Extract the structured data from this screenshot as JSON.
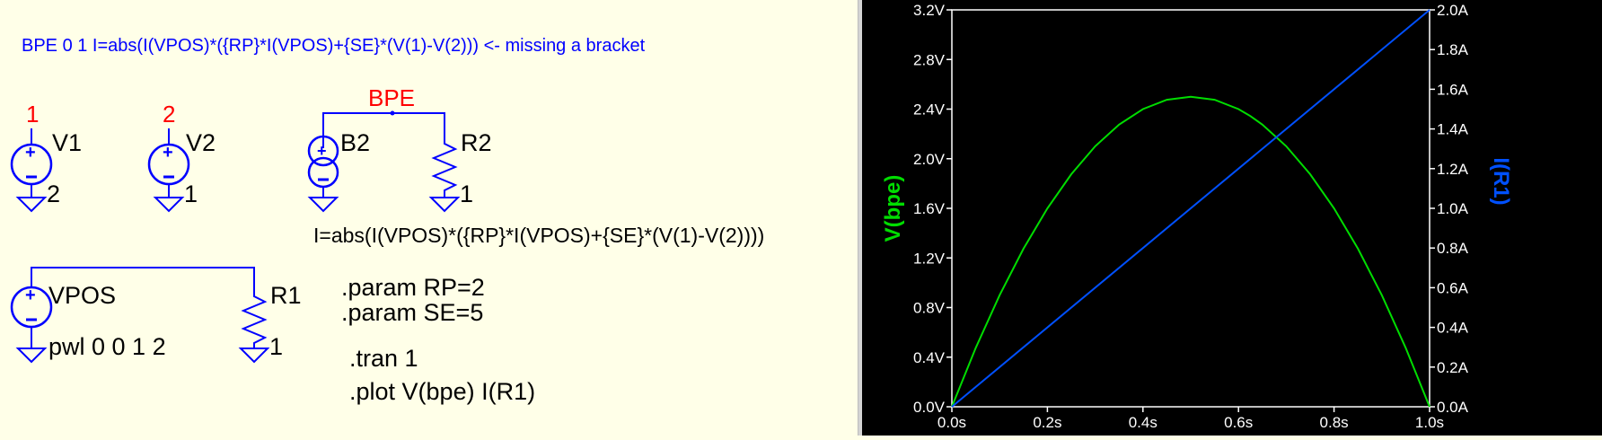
{
  "schematic": {
    "comment": "BPE 0 1 I=abs(I(VPOS)*({RP}*I(VPOS)+{SE}*(V(1)-V(2))) <- missing a bracket",
    "net_labels": {
      "n1": "1",
      "n2": "2",
      "bpe": "BPE"
    },
    "components": {
      "v1": {
        "name": "V1",
        "node": "2"
      },
      "v2": {
        "name": "V2",
        "node": "1"
      },
      "b2": {
        "name": "B2"
      },
      "r2": {
        "name": "R2",
        "value": "1"
      },
      "vpos": {
        "name": "VPOS",
        "value": "pwl 0 0 1 2"
      },
      "r1": {
        "name": "R1",
        "value": "1"
      }
    },
    "b2_expression": "I=abs(I(VPOS)*({RP}*I(VPOS)+{SE}*(V(1)-V(2))))",
    "directives": {
      "param_rp": ".param RP=2",
      "param_se": ".param SE=5",
      "tran": ".tran 1",
      "plot": ".plot V(bpe) I(R1)"
    }
  },
  "colors": {
    "wire": "#0000ff",
    "net_label": "#ff0000",
    "text": "#000000",
    "comment": "#0000ff",
    "plot_bg": "#000000",
    "axis": "#ffffff",
    "trace_vbpe": "#00dd00",
    "trace_ir1": "#0050ff"
  },
  "chart_data": {
    "type": "line",
    "xlabel": "",
    "left_axis_label": "V(bpe)",
    "right_axis_label": "I(R1)",
    "x_ticks": [
      "0.0s",
      "0.2s",
      "0.4s",
      "0.6s",
      "0.8s",
      "1.0s"
    ],
    "y_left_ticks": [
      "0.0V",
      "0.4V",
      "0.8V",
      "1.2V",
      "1.6V",
      "2.0V",
      "2.4V",
      "2.8V",
      "3.2V"
    ],
    "y_right_ticks": [
      "0.0A",
      "0.2A",
      "0.4A",
      "0.6A",
      "0.8A",
      "1.0A",
      "1.2A",
      "1.4A",
      "1.6A",
      "1.8A",
      "2.0A"
    ],
    "xlim": [
      0,
      1.0
    ],
    "ylim_left": [
      0,
      3.2
    ],
    "ylim_right": [
      0,
      2.0
    ],
    "grid": false,
    "series": [
      {
        "name": "V(bpe)",
        "axis": "left",
        "x": [
          0,
          0.05,
          0.1,
          0.15,
          0.2,
          0.25,
          0.3,
          0.35,
          0.4,
          0.45,
          0.5,
          0.55,
          0.6,
          0.625,
          0.65,
          0.7,
          0.75,
          0.8,
          0.85,
          0.9,
          0.95,
          1.0
        ],
        "y": [
          0,
          0.475,
          0.9,
          1.275,
          1.6,
          1.875,
          2.1,
          2.275,
          2.4,
          2.475,
          2.5,
          2.475,
          2.4,
          2.34375,
          2.275,
          2.1,
          1.875,
          1.6,
          1.275,
          0.9,
          0.475,
          0
        ]
      },
      {
        "name": "I(R1)",
        "axis": "right",
        "x": [
          0,
          1.0
        ],
        "y": [
          0,
          2.0
        ]
      }
    ]
  }
}
